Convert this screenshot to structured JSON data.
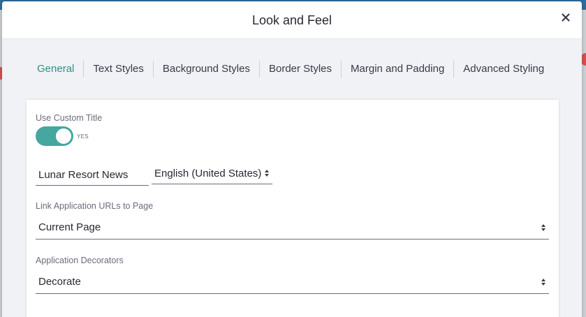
{
  "modal": {
    "title": "Look and Feel"
  },
  "tabs": [
    {
      "label": "General",
      "active": true
    },
    {
      "label": "Text Styles",
      "active": false
    },
    {
      "label": "Background Styles",
      "active": false
    },
    {
      "label": "Border Styles",
      "active": false
    },
    {
      "label": "Margin and Padding",
      "active": false
    },
    {
      "label": "Advanced Styling",
      "active": false
    }
  ],
  "general": {
    "custom_title_label": "Use Custom Title",
    "custom_title_toggle_state": "YES",
    "custom_title_value": "Lunar Resort News",
    "language_selected": "English (United States)",
    "link_urls_label": "Link Application URLs to Page",
    "link_urls_selected": "Current Page",
    "decorators_label": "Application Decorators",
    "decorators_selected": "Decorate"
  },
  "colors": {
    "accent": "#46a6a0",
    "active_tab": "#2e8f8a",
    "text": "#272833",
    "muted": "#6b6c7e"
  },
  "icons": {
    "close": "close-icon",
    "select": "select-arrows-icon"
  }
}
